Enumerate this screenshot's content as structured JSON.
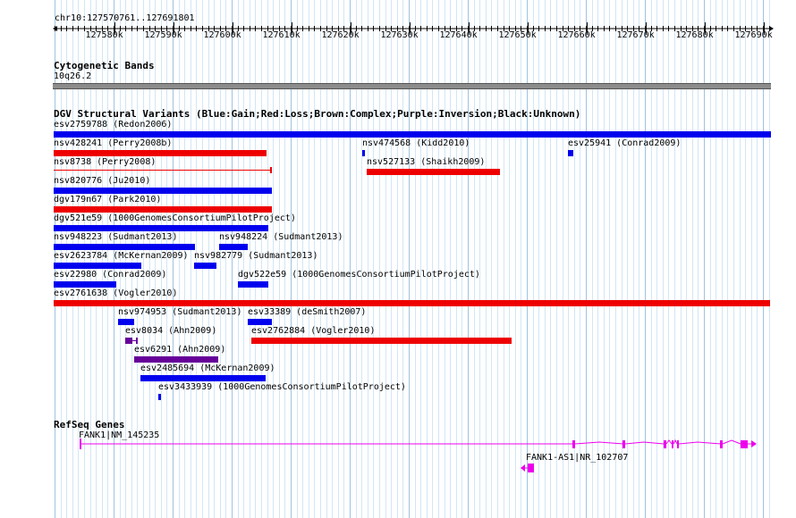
{
  "ruler": {
    "location": "chr10:127570761..127691801",
    "ticks": [
      "127580k",
      "127590k",
      "127600k",
      "127610k",
      "127620k",
      "127630k",
      "127640k",
      "127650k",
      "127660k",
      "127670k",
      "127680k",
      "127690k"
    ]
  },
  "cytoband": {
    "title": "Cytogenetic Bands",
    "band": "10q26.2"
  },
  "dgv": {
    "title": "DGV Structural Variants (Blue:Gain;Red:Loss;Brown:Complex;Purple:Inversion;Black:Unknown)",
    "colors": {
      "gain": "#0000ee",
      "loss": "#ee0000",
      "inversion": "#660099",
      "complex": "#8b4513",
      "unknown": "#000000"
    },
    "features": [
      {
        "label": "esv2759788 (Redon2006)",
        "type": "gain"
      },
      {
        "label": "nsv428241 (Perry2008b)",
        "type": "loss"
      },
      {
        "label": "nsv474568 (Kidd2010)",
        "type": "gain"
      },
      {
        "label": "esv25941 (Conrad2009)",
        "type": "gain"
      },
      {
        "label": "nsv8738 (Perry2008)",
        "type": "loss"
      },
      {
        "label": "nsv527133 (Shaikh2009)",
        "type": "loss"
      },
      {
        "label": "nsv820776 (Ju2010)",
        "type": "gain"
      },
      {
        "label": "dgv179n67 (Park2010)",
        "type": "loss"
      },
      {
        "label": "dgv521e59 (1000GenomesConsortiumPilotProject)",
        "type": "gain"
      },
      {
        "label": "nsv948223 (Sudmant2013)",
        "type": "gain"
      },
      {
        "label": "nsv948224 (Sudmant2013)",
        "type": "gain"
      },
      {
        "label": "esv2623784 (McKernan2009)",
        "type": "gain"
      },
      {
        "label": "nsv982779 (Sudmant2013)",
        "type": "gain"
      },
      {
        "label": "esv22980 (Conrad2009)",
        "type": "gain"
      },
      {
        "label": "dgv522e59 (1000GenomesConsortiumPilotProject)",
        "type": "gain"
      },
      {
        "label": "esv2761638 (Vogler2010)",
        "type": "loss"
      },
      {
        "label": "nsv974953 (Sudmant2013)",
        "type": "gain"
      },
      {
        "label": "esv33389 (deSmith2007)",
        "type": "gain"
      },
      {
        "label": "esv8034 (Ahn2009)",
        "type": "inversion"
      },
      {
        "label": "esv2762884 (Vogler2010)",
        "type": "loss"
      },
      {
        "label": "esv6291 (Ahn2009)",
        "type": "inversion"
      },
      {
        "label": "esv2485694 (McKernan2009)",
        "type": "gain"
      },
      {
        "label": "esv3433939 (1000GenomesConsortiumPilotProject)",
        "type": "gain"
      }
    ]
  },
  "refseq": {
    "title": "RefSeq Genes",
    "color": "#ee00ee",
    "genes": [
      {
        "label": "FANK1|NM_145235",
        "strand": "+"
      },
      {
        "label": "FANK1-AS1|NR_102707",
        "strand": "-"
      }
    ]
  }
}
